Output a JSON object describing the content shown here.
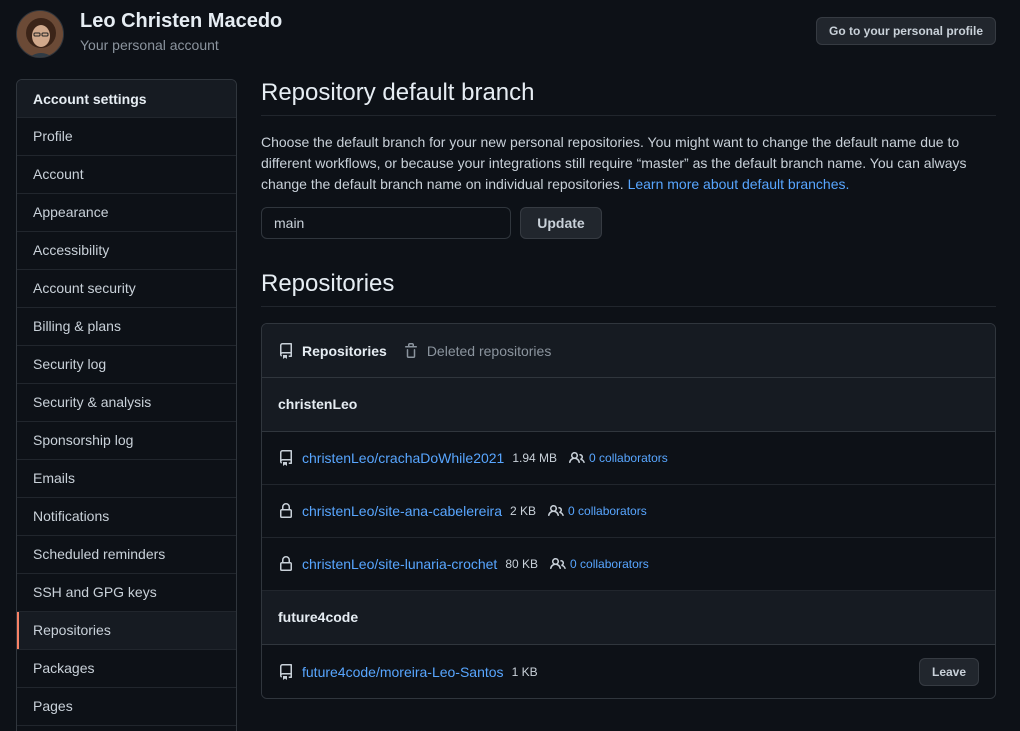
{
  "header": {
    "name": "Leo Christen Macedo",
    "subtitle": "Your personal account",
    "profile_button": "Go to your personal profile"
  },
  "sidebar": {
    "heading": "Account settings",
    "items": [
      {
        "label": "Profile"
      },
      {
        "label": "Account"
      },
      {
        "label": "Appearance"
      },
      {
        "label": "Accessibility"
      },
      {
        "label": "Account security"
      },
      {
        "label": "Billing & plans"
      },
      {
        "label": "Security log"
      },
      {
        "label": "Security & analysis"
      },
      {
        "label": "Sponsorship log"
      },
      {
        "label": "Emails"
      },
      {
        "label": "Notifications"
      },
      {
        "label": "Scheduled reminders"
      },
      {
        "label": "SSH and GPG keys"
      },
      {
        "label": "Repositories"
      },
      {
        "label": "Packages"
      },
      {
        "label": "Pages"
      }
    ],
    "selected": "Repositories"
  },
  "default_branch": {
    "title": "Repository default branch",
    "description": "Choose the default branch for your new personal repositories. You might want to change the default name due to different workflows, or because your integrations still require “master” as the default branch name. You can always change the default branch name on individual repositories.",
    "learn_more": "Learn more about default branches.",
    "input_value": "main",
    "update_button": "Update"
  },
  "repositories": {
    "title": "Repositories",
    "tabs": {
      "active": "Repositories",
      "deleted": "Deleted repositories"
    },
    "groups": [
      {
        "owner": "christenLeo",
        "repos": [
          {
            "name": "christenLeo/crachaDoWhile2021",
            "size": "1.94 MB",
            "collaborators": "0 collaborators",
            "icon": "repo-icon"
          },
          {
            "name": "christenLeo/site-ana-cabelereira",
            "size": "2 KB",
            "collaborators": "0 collaborators",
            "icon": "lock-icon"
          },
          {
            "name": "christenLeo/site-lunaria-crochet",
            "size": "80 KB",
            "collaborators": "0 collaborators",
            "icon": "lock-icon"
          }
        ]
      },
      {
        "owner": "future4code",
        "repos": [
          {
            "name": "future4code/moreira-Leo-Santos",
            "size": "1 KB",
            "icon": "repo-icon",
            "action": "Leave"
          }
        ]
      }
    ]
  }
}
